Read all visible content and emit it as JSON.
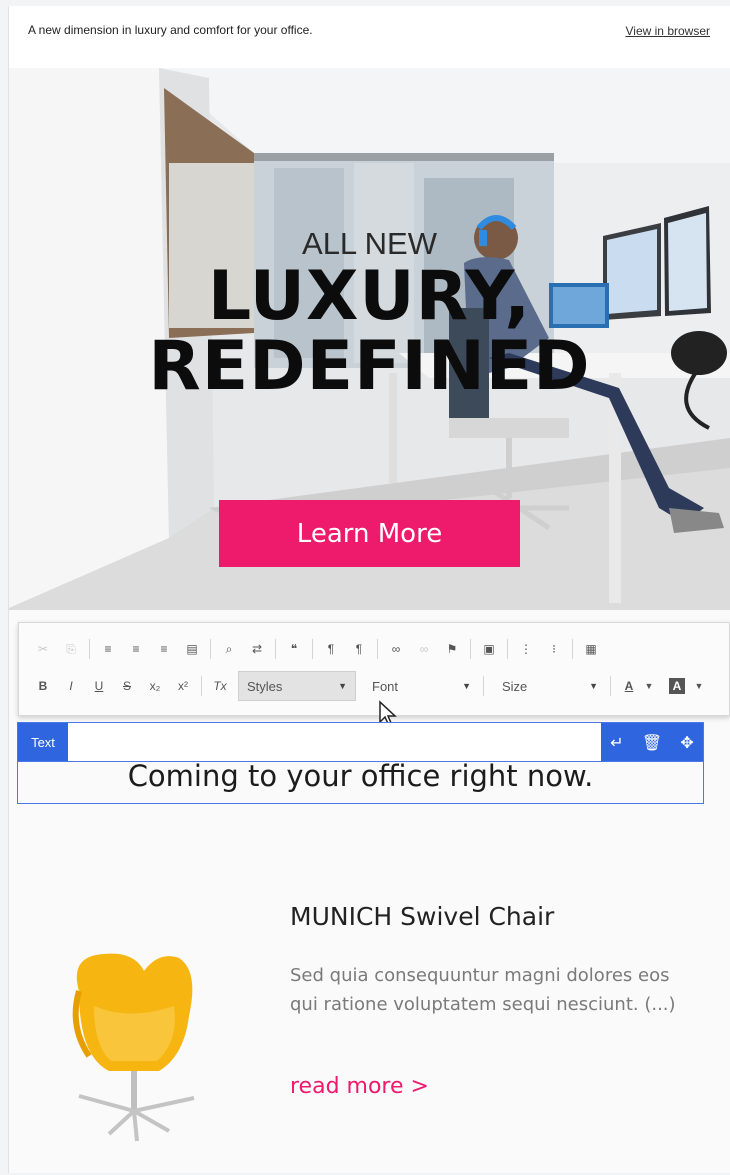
{
  "preheader": {
    "tagline": "A new dimension in luxury and comfort for your office.",
    "view_in_browser": "View in browser"
  },
  "hero": {
    "kicker": "ALL NEW",
    "headline_line1": "LUXURY,",
    "headline_line2": "REDEFINED",
    "cta_label": "Learn More",
    "cta_color": "#ee1a6c"
  },
  "toolbar": {
    "row1_icons": [
      "cut-icon",
      "copy-icon",
      "align-left-icon",
      "align-center-icon",
      "align-right-icon",
      "align-justify-icon",
      "find-icon",
      "replace-icon",
      "blockquote-icon",
      "ltr-icon",
      "rtl-icon",
      "link-icon",
      "unlink-icon",
      "anchor-icon",
      "paste-from-word-icon",
      "numbered-list-icon",
      "bulleted-list-icon",
      "table-icon"
    ],
    "bold": "B",
    "italic": "I",
    "underline": "U",
    "strike": "S",
    "subscript": "x₂",
    "superscript": "x²",
    "clear_format": "Tx",
    "styles": "Styles",
    "font": "Font",
    "size": "Size",
    "text_color": "A",
    "bg_color": "A"
  },
  "text_block": {
    "badge": "Text",
    "content": "Coming to your office right now.",
    "accent_color": "#2f66df"
  },
  "product": {
    "title": "MUNICH Swivel Chair",
    "description": "Sed quia consequuntur magni dolores eos qui ratione voluptatem sequi nesciunt. (...)",
    "link": "read more >",
    "link_color": "#ee1a6c"
  }
}
